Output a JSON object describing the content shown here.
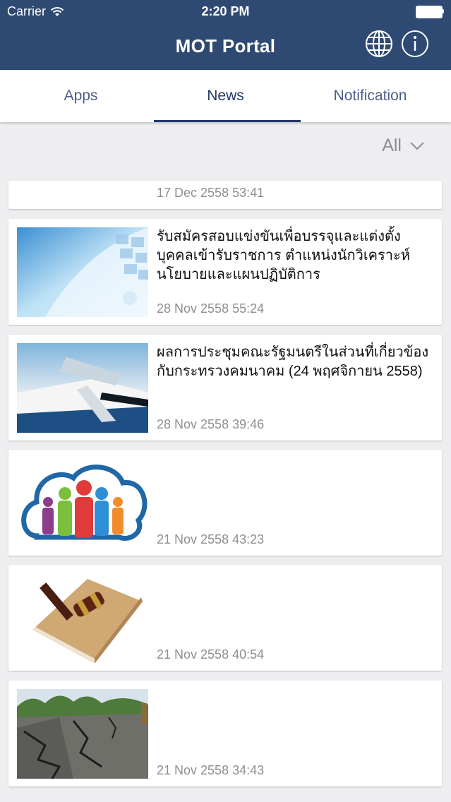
{
  "status_bar": {
    "carrier": "Carrier",
    "time": "2:20 PM"
  },
  "header": {
    "title": "MOT Portal",
    "globe_icon": "globe-icon",
    "info_icon": "info-icon"
  },
  "tabs": [
    {
      "label": "Apps",
      "active": false
    },
    {
      "label": "News",
      "active": true
    },
    {
      "label": "Notification",
      "active": false
    }
  ],
  "filter": {
    "label": "All"
  },
  "news": [
    {
      "headline": "",
      "date": "17 Dec 2558 53:41"
    },
    {
      "headline": "รับสมัครสอบแข่งขันเพื่อบรรจุและแต่งตั้งบุคคลเข้ารับราชการ ตำแหน่งนักวิเคราะห์นโยบายและแผนปฏิบัติการ",
      "date": "28 Nov 2558 55:24",
      "thumbnail": "technology-screens-image"
    },
    {
      "headline": "ผลการประชุมคณะรัฐมนตรีในส่วนที่เกี่ยวข้องกับกระทรวงคมนาคม (24 พฤศจิกายน 2558)",
      "date": "28 Nov 2558 39:46",
      "thumbnail": "transport-collage-image"
    },
    {
      "headline": "",
      "date": "21 Nov 2558 43:23",
      "thumbnail": "people-cloud-logo"
    },
    {
      "headline": "",
      "date": "21 Nov 2558 40:54",
      "thumbnail": "gavel-book-image"
    },
    {
      "headline": "",
      "date": "21 Nov 2558 34:43",
      "thumbnail": "cracked-road-image"
    }
  ]
}
